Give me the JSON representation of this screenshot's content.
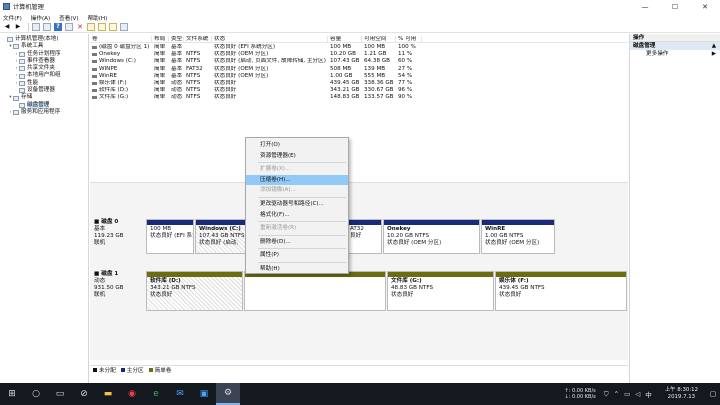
{
  "window": {
    "title": "计算机管理",
    "controls": {
      "minimize": "—",
      "maximize": "☐",
      "close": "✕"
    }
  },
  "menu": [
    "文件(F)",
    "操作(A)",
    "查看(V)",
    "帮助(H)"
  ],
  "tree": [
    {
      "label": "计算机管理(本地)",
      "exp": "",
      "indent": 0
    },
    {
      "label": "系统工具",
      "exp": "▾",
      "indent": 1
    },
    {
      "label": "任务计划程序",
      "exp": "›",
      "indent": 2
    },
    {
      "label": "事件查看器",
      "exp": "›",
      "indent": 2
    },
    {
      "label": "共享文件夹",
      "exp": "›",
      "indent": 2
    },
    {
      "label": "本地用户和组",
      "exp": "›",
      "indent": 2
    },
    {
      "label": "性能",
      "exp": "›",
      "indent": 2
    },
    {
      "label": "设备管理器",
      "exp": "",
      "indent": 2
    },
    {
      "label": "存储",
      "exp": "▾",
      "indent": 1
    },
    {
      "label": "磁盘管理",
      "exp": "",
      "indent": 2,
      "selected": true
    },
    {
      "label": "服务和应用程序",
      "exp": "›",
      "indent": 1
    }
  ],
  "volume_columns": [
    "卷",
    "布局",
    "类型",
    "文件系统",
    "状态",
    "容量",
    "可用空间",
    "% 可用"
  ],
  "volumes": [
    [
      "(磁盘 0 磁盘分区 1)",
      "简单",
      "基本",
      "",
      "状态良好 (EFI 系统分区)",
      "100 MB",
      "100 MB",
      "100 %"
    ],
    [
      "Onekey",
      "简单",
      "基本",
      "NTFS",
      "状态良好 (OEM 分区)",
      "10.20 GB",
      "1.21 GB",
      "11 %"
    ],
    [
      "Windows (C:)",
      "简单",
      "基本",
      "NTFS",
      "状态良好 (启动, 页面文件, 故障转储, 主分区)",
      "107.43 GB",
      "64.38 GB",
      "60 %"
    ],
    [
      "WINPE",
      "简单",
      "基本",
      "FAT32",
      "状态良好 (OEM 分区)",
      "508 MB",
      "139 MB",
      "27 %"
    ],
    [
      "WinRE",
      "简单",
      "基本",
      "NTFS",
      "状态良好 (OEM 分区)",
      "1.00 GB",
      "555 MB",
      "54 %"
    ],
    [
      "娱乐体 (F:)",
      "简单",
      "动态",
      "NTFS",
      "状态良好",
      "439.45 GB",
      "338.36 GB",
      "77 %"
    ],
    [
      "软件库 (D:)",
      "简单",
      "动态",
      "NTFS",
      "状态良好",
      "343.21 GB",
      "330.67 GB",
      "96 %"
    ],
    [
      "文件库 (G:)",
      "简单",
      "动态",
      "NTFS",
      "状态良好",
      "148.83 GB",
      "133.57 GB",
      "90 %"
    ]
  ],
  "disk0": {
    "label": "磁盘 0",
    "type": "基本",
    "size": "119.23 GB",
    "status": "联机",
    "partitions": [
      {
        "name": "",
        "line1": "100 MB",
        "line2": "状态良好 (EFI 系)"
      },
      {
        "name": "Windows  (C:)",
        "line1": "107.43 GB NTFS",
        "line2": "状态良好 (启动,"
      },
      {
        "name": "",
        "line1": "AT32",
        "line2": "艮好"
      },
      {
        "name": "Onekey",
        "line1": "10.20 GB NTFS",
        "line2": "状态良好 (OEM 分区)"
      },
      {
        "name": "WinRE",
        "line1": "1.00 GB NTFS",
        "line2": "状态良好 (OEM 分区)"
      }
    ]
  },
  "disk1": {
    "label": "磁盘 1",
    "type": "动态",
    "size": "931.50 GB",
    "status": "联机",
    "partitions": [
      {
        "name": "软件库  (D:)",
        "line1": "343.21 GB NTFS",
        "line2": "状态良好"
      },
      {
        "name": "文件库  (G:)",
        "line1": "48.83 GB NTFS",
        "line2": "状态良好"
      },
      {
        "name": "娱乐体  (F:)",
        "line1": "439.45 GB NTFS",
        "line2": "状态良好"
      }
    ]
  },
  "legend": [
    {
      "label": "未分配",
      "color": "#111111"
    },
    {
      "label": "主分区",
      "color": "#1a2a7a"
    },
    {
      "label": "简单卷",
      "color": "#6c6c10"
    }
  ],
  "context_menu": [
    {
      "label": "打开(O)",
      "disabled": false
    },
    {
      "label": "资源管理器(E)",
      "disabled": false
    },
    {
      "sep": true
    },
    {
      "label": "扩展卷(X)...",
      "disabled": true
    },
    {
      "label": "压缩卷(H)...",
      "disabled": false,
      "highlight": true
    },
    {
      "label": "添加镜像(A)...",
      "disabled": true
    },
    {
      "sep": true
    },
    {
      "label": "更改驱动器号和路径(C)...",
      "disabled": false
    },
    {
      "label": "格式化(F)...",
      "disabled": false
    },
    {
      "sep": true
    },
    {
      "label": "重新激活卷(R)",
      "disabled": true
    },
    {
      "sep": true
    },
    {
      "label": "删除卷(D)...",
      "disabled": false
    },
    {
      "sep": true
    },
    {
      "label": "属性(P)",
      "disabled": false
    },
    {
      "sep": true
    },
    {
      "label": "帮助(H)",
      "disabled": false
    }
  ],
  "ops": {
    "title": "操作",
    "section": "磁盘管理",
    "more": "更多操作",
    "section_arrow": "▲",
    "more_arrow": "▶"
  },
  "taskbar": {
    "icons": [
      "start-icon",
      "search-icon",
      "task-view-icon",
      "no-entry-icon",
      "explorer-icon",
      "chrome-icon",
      "edge-icon",
      "mail-icon",
      "photos-icon",
      "computer-management-icon"
    ],
    "net_up": "↑: 0.00 KB/s",
    "net_down": "↓: 0.00 KB/s",
    "time": "上午 8:30:12",
    "date": "2019.7.13"
  }
}
